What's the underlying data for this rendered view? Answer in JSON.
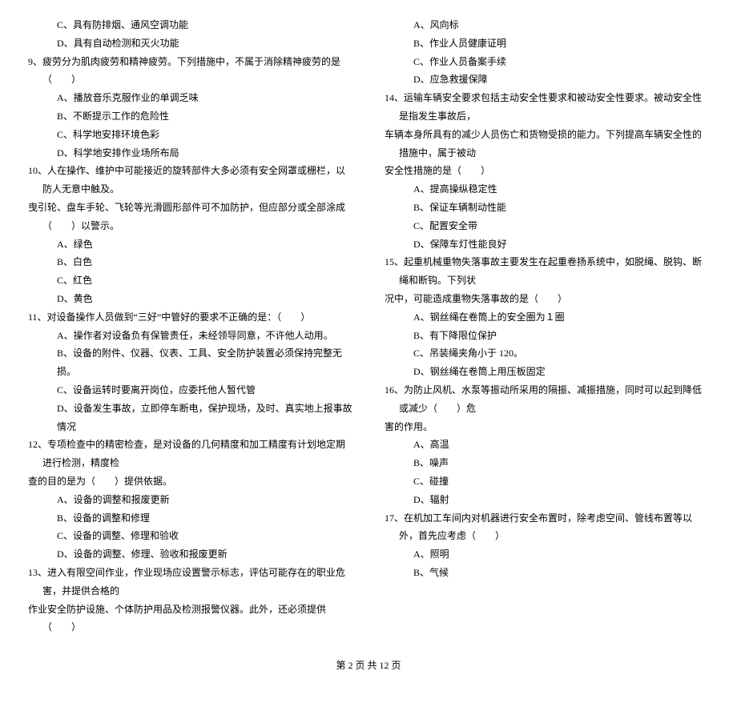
{
  "left": {
    "q8c": "C、具有防排烟、通风空调功能",
    "q8d": "D、具有自动检测和灭火功能",
    "q9": "9、疲劳分为肌肉疲劳和精神疲劳。下列措施中，不属于消除精神疲劳的是（　　）",
    "q9a": "A、播放音乐克服作业的单调乏味",
    "q9b": "B、不断提示工作的危险性",
    "q9c": "C、科学地安排环境色彩",
    "q9d": "D、科学地安排作业场所布局",
    "q10a": "10、人在操作、维护中可能接近的旋转部件大多必须有安全网罩或栅栏，以防人无意中触及。",
    "q10b": "曳引轮、盘车手轮、飞轮等光滑圆形部件可不加防护，但应部分或全部涂成（　　）以警示。",
    "q10oa": "A、绿色",
    "q10ob": "B、白色",
    "q10oc": "C、红色",
    "q10od": "D、黄色",
    "q11": "11、对设备操作人员做到“三好”中管好的要求不正确的是：（　　）",
    "q11a": "A、操作者对设备负有保管责任，未经领导同意，不许他人动用。",
    "q11b": "B、设备的附件、仪器、仪表、工具、安全防护装置必须保持完整无损。",
    "q11c": "C、设备运转时要离开岗位，应委托他人暂代管",
    "q11d": "D、设备发生事故，立即停车断电，保护现场，及时、真实地上报事故情况",
    "q12a": "12、专项检查中的精密检查，是对设备的几何精度和加工精度有计划地定期进行检测，精度检",
    "q12b": "查的目的是为（　　）提供依据。",
    "q12oa": "A、设备的调整和报废更新",
    "q12ob": "B、设备的调整和修理",
    "q12oc": "C、设备的调整、修理和验收",
    "q12od": "D、设备的调整、修理、验收和报废更新",
    "q13a": "13、进入有限空间作业，作业现场应设置警示标志，评估可能存在的职业危害，并提供合格的",
    "q13b": "作业安全防护设施、个体防护用品及检测报警仪器。此外，还必须提供（　　）"
  },
  "right": {
    "q13oa": "A、风向标",
    "q13ob": "B、作业人员健康证明",
    "q13oc": "C、作业人员备案手续",
    "q13od": "D、应急救援保障",
    "q14a": "14、运输车辆安全要求包括主动安全性要求和被动安全性要求。被动安全性是指发生事故后，",
    "q14b": "车辆本身所具有的减少人员伤亡和货物受损的能力。下列提高车辆安全性的措施中，属于被动",
    "q14c": "安全性措施的是（　　）",
    "q14oa": "A、提高操纵稳定性",
    "q14ob": "B、保证车辆制动性能",
    "q14oc": "C、配置安全带",
    "q14od": "D、保障车灯性能良好",
    "q15a": "15、起重机械重物失落事故主要发生在起重卷扬系统中，如脱绳、脱钩、断绳和断钩。下列状",
    "q15b": "况中，可能造成重物失落事故的是（　　）",
    "q15oa": "A、钢丝绳在卷筒上的安全圈为１圈",
    "q15ob": "B、有下降限位保护",
    "q15oc": "C、吊装绳夹角小于 120。",
    "q15od": "D、钢丝绳在卷筒上用压板固定",
    "q16a": "16、为防止风机、水泵等振动所采用的隔振、减振措施，同时可以起到降低或减少（　　）危",
    "q16b": "害的作用。",
    "q16oa": "A、高温",
    "q16ob": "B、噪声",
    "q16oc": "C、碰撞",
    "q16od": "D、辐射",
    "q17": "17、在机加工车间内对机器进行安全布置时，除考虑空间、管线布置等以外，首先应考虑（　　）",
    "q17a": "A、照明",
    "q17b": "B、气候"
  },
  "footer": "第 2 页 共 12 页"
}
